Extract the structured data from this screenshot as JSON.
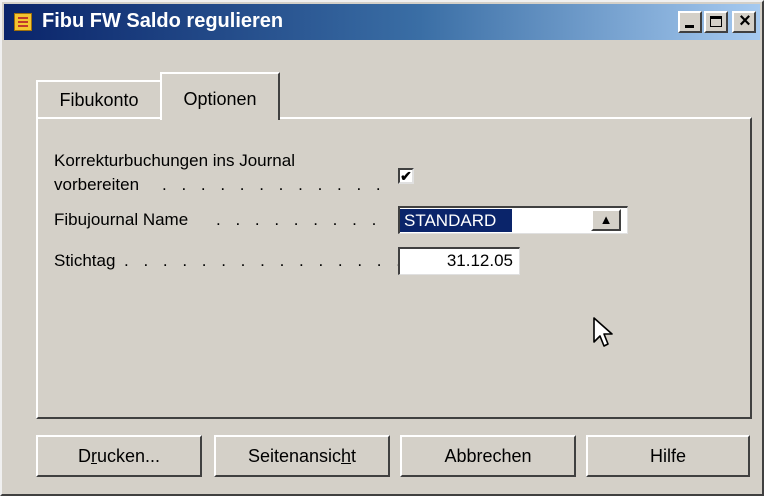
{
  "window": {
    "title": "Fibu FW Saldo regulieren"
  },
  "tabs": [
    {
      "label": "Fibukonto",
      "active": false
    },
    {
      "label": "Optionen",
      "active": true
    }
  ],
  "options": {
    "korrektur_label_line1": "Korrekturbuchungen ins Journal",
    "korrektur_label_line2": "vorbereiten",
    "korrektur_checked": true,
    "journal_label": "Fibujournal Name",
    "journal_value": "STANDARD",
    "stichtag_label": "Stichtag",
    "stichtag_value": "31.12.05"
  },
  "buttons": {
    "print_pre": "D",
    "print_mnemonic": "r",
    "print_post": "ucken...",
    "preview_pre": "Seitenansic",
    "preview_mnemonic": "h",
    "preview_post": "t",
    "cancel": "Abbrechen",
    "help": "Hilfe"
  },
  "icons": {
    "app": "form-icon",
    "lookup": "arrow-up-icon",
    "cursor": "mouse-pointer-icon"
  }
}
